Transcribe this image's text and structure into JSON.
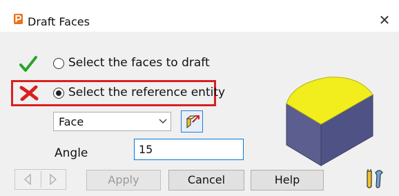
{
  "window": {
    "title": "Draft Faces",
    "close_glyph": "✕"
  },
  "options": [
    {
      "label": "Select the faces to draft",
      "selected": false,
      "status_icon": "green-check-icon"
    },
    {
      "label": "Select the reference entity",
      "selected": true,
      "status_icon": "red-cross-icon",
      "highlighted": true
    }
  ],
  "reference_type": {
    "value": "Face"
  },
  "angle": {
    "label": "Angle",
    "value": "15"
  },
  "buttons": {
    "apply": "Apply",
    "cancel": "Cancel",
    "help": "Help"
  },
  "colors": {
    "check": "#2aa42a",
    "cross": "#d9201f",
    "highlight": "#d9201f",
    "face_top": "#f2ee1e",
    "face_side": "#5b5e8e"
  }
}
